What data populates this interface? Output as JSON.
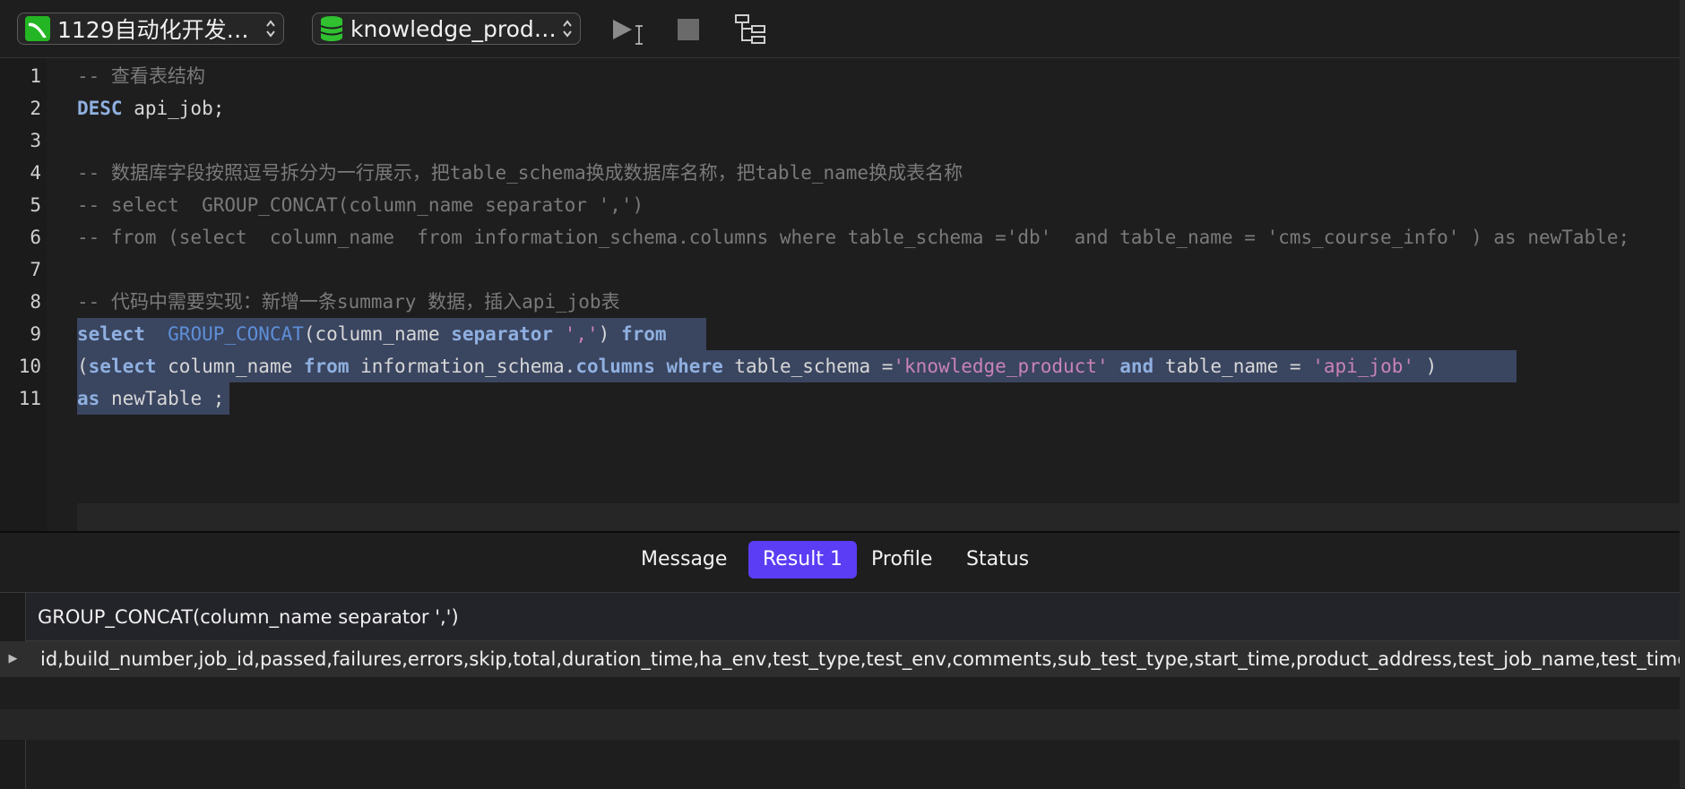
{
  "toolbar": {
    "connection_label": "1129自动化开发环...",
    "database_label": "knowledge_product",
    "icons": {
      "connection": "mysql-connection-icon",
      "database": "database-icon",
      "run": "play-icon",
      "stop": "stop-icon",
      "explain": "tree-structure-icon"
    }
  },
  "editor": {
    "line_numbers": [
      "1",
      "2",
      "3",
      "4",
      "5",
      "6",
      "7",
      "8",
      "9",
      "10",
      "11"
    ],
    "lines": [
      [
        {
          "t": "-- 查看表结构",
          "c": "cm"
        }
      ],
      [
        {
          "t": "DESC",
          "c": "kw"
        },
        {
          "t": " api_job;",
          "c": "plain"
        }
      ],
      [],
      [
        {
          "t": "-- 数据库字段按照逗号拆分为一行展示，把table_schema换成数据库名称，把table_name换成表名称",
          "c": "cm"
        }
      ],
      [
        {
          "t": "-- select  GROUP_CONCAT(column_name separator ',')",
          "c": "cm"
        }
      ],
      [
        {
          "t": "-- from (select  column_name  from information_schema.columns where table_schema ='db'  and table_name = 'cms_course_info' ) as newTable;",
          "c": "cm"
        }
      ],
      [],
      [
        {
          "t": "-- 代码中需要实现：新增一条summary 数据，插入api_job表",
          "c": "cm"
        }
      ],
      [
        {
          "t": "select",
          "c": "kw"
        },
        {
          "t": "  ",
          "c": "plain"
        },
        {
          "t": "GROUP_CONCAT",
          "c": "fn"
        },
        {
          "t": "(column_name ",
          "c": "plain"
        },
        {
          "t": "separator",
          "c": "kw"
        },
        {
          "t": " ",
          "c": "plain"
        },
        {
          "t": "','",
          "c": "str"
        },
        {
          "t": ") ",
          "c": "plain"
        },
        {
          "t": "from",
          "c": "kw"
        },
        {
          "t": "  ",
          "c": "plain"
        }
      ],
      [
        {
          "t": "(",
          "c": "plain"
        },
        {
          "t": "select",
          "c": "kw"
        },
        {
          "t": " column_name ",
          "c": "plain"
        },
        {
          "t": "from",
          "c": "kw"
        },
        {
          "t": " information_schema.",
          "c": "plain"
        },
        {
          "t": "columns",
          "c": "kw"
        },
        {
          "t": " ",
          "c": "plain"
        },
        {
          "t": "where",
          "c": "kw"
        },
        {
          "t": " table_schema =",
          "c": "plain"
        },
        {
          "t": "'knowledge_product'",
          "c": "str"
        },
        {
          "t": " ",
          "c": "plain"
        },
        {
          "t": "and",
          "c": "kw"
        },
        {
          "t": " table_name = ",
          "c": "plain"
        },
        {
          "t": "'api_job'",
          "c": "str"
        },
        {
          "t": " ) ",
          "c": "plain"
        }
      ],
      [
        {
          "t": "as",
          "c": "kw"
        },
        {
          "t": " newTable ;",
          "c": "plain"
        }
      ]
    ],
    "selected_lines": [
      9,
      10,
      11
    ]
  },
  "tabs": [
    {
      "label": "Message",
      "active": false
    },
    {
      "label": "Result 1",
      "active": true
    },
    {
      "label": "Profile",
      "active": false
    },
    {
      "label": "Status",
      "active": false
    }
  ],
  "result": {
    "column_header": "GROUP_CONCAT(column_name separator ',')",
    "rows": [
      "id,build_number,job_id,passed,failures,errors,skip,total,duration_time,ha_env,test_type,test_env,comments,sub_test_type,start_time,product_address,test_job_name,test_time"
    ],
    "row_marker": "▶"
  },
  "colors": {
    "accent": "#5b3df5",
    "selection": "#3a4560",
    "keyword": "#8fb0e0",
    "function": "#5e8fd8",
    "string": "#c983b5",
    "comment": "#7a7a7a"
  }
}
